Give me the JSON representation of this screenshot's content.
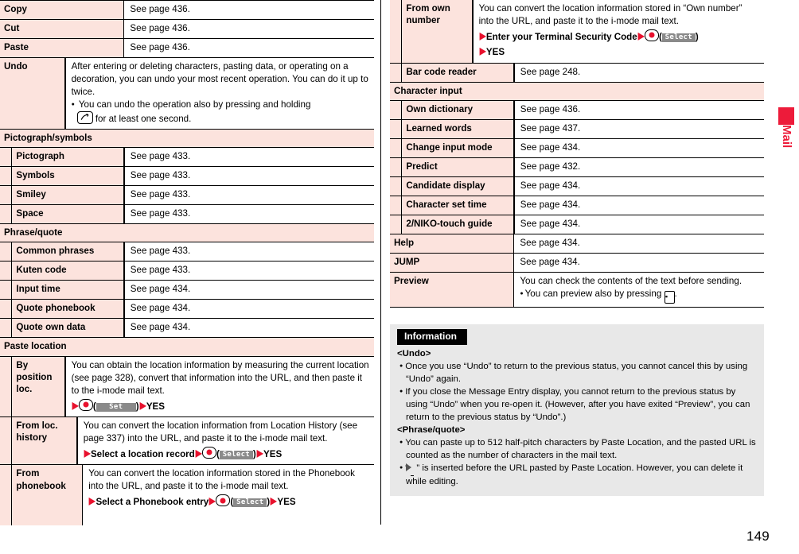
{
  "page": {
    "number": "149",
    "side_tab": "Mail",
    "accent_color": "#ed1b3a",
    "row_label_bg": "#fce3dd",
    "info_bg": "#e8e8e8"
  },
  "left_column": {
    "rows": [
      {
        "kind": "item",
        "indent": 0,
        "label": "Copy",
        "desc": "See page 436."
      },
      {
        "kind": "item",
        "indent": 0,
        "label": "Cut",
        "desc": "See page 436."
      },
      {
        "kind": "item",
        "indent": 0,
        "label": "Paste",
        "desc": "See page 436."
      },
      {
        "kind": "item",
        "indent": 0,
        "label": "Undo",
        "desc": "After entering or deleting characters, pasting data, or operating on a decoration, you can undo your most recent operation. You can do it up to twice.",
        "bullets": [
          "You can undo the operation also by pressing and holding"
        ],
        "bullet_tail": "for at least one second.",
        "bullet_icon": "call-key-icon"
      },
      {
        "kind": "section",
        "indent": 0,
        "label": "Pictograph/symbols"
      },
      {
        "kind": "item",
        "indent": 1,
        "label": "Pictograph",
        "desc": "See page 433."
      },
      {
        "kind": "item",
        "indent": 1,
        "label": "Symbols",
        "desc": "See page 433."
      },
      {
        "kind": "item",
        "indent": 1,
        "label": "Smiley",
        "desc": "See page 433."
      },
      {
        "kind": "item",
        "indent": 1,
        "label": "Space",
        "desc": "See page 433."
      },
      {
        "kind": "section",
        "indent": 0,
        "label": "Phrase/quote"
      },
      {
        "kind": "item",
        "indent": 1,
        "label": "Common phrases",
        "desc": "See page 433."
      },
      {
        "kind": "item",
        "indent": 1,
        "label": "Kuten code",
        "desc": "See page 433."
      },
      {
        "kind": "item",
        "indent": 1,
        "label": "Input time",
        "desc": "See page 434."
      },
      {
        "kind": "item",
        "indent": 1,
        "label": "Quote phonebook",
        "desc": "See page 434."
      },
      {
        "kind": "item",
        "indent": 1,
        "label": "Quote own data",
        "desc": "See page 434."
      },
      {
        "kind": "section",
        "indent": 0,
        "label": "Paste location"
      },
      {
        "kind": "item",
        "indent": 1,
        "label": "By position loc.",
        "desc": "You can obtain the location information by measuring the current location (see page 328), convert that information into the URL, and then paste it to the i-mode mail text.",
        "ops": {
          "softkey": "Set",
          "steps": [
            "",
            "YES"
          ]
        }
      },
      {
        "kind": "item",
        "indent": 1,
        "label": "From loc. history",
        "desc": "You can convert the location information from Location History (see page 337) into the URL, and paste it to the i-mode mail text.",
        "ops": {
          "softkey": "Select",
          "steps": [
            "Select a location record",
            "YES"
          ]
        }
      },
      {
        "kind": "item",
        "indent": 1,
        "label": "From phonebook",
        "desc": "You can convert the location information stored in the Phonebook into the URL, and paste it to the i-mode mail text.",
        "ops": {
          "softkey": "Select",
          "steps": [
            "Select a Phonebook entry",
            "YES"
          ]
        }
      }
    ]
  },
  "right_column": {
    "rows": [
      {
        "kind": "item",
        "indent": 1,
        "label": "From own number",
        "desc": "You can convert the location information stored in “Own number” into the URL, and paste it to the i-mode mail text.",
        "ops": {
          "softkey": "Select",
          "steps": [
            "Enter your Terminal Security Code",
            "YES"
          ]
        }
      },
      {
        "kind": "item",
        "indent": 1,
        "label": "Bar code reader",
        "desc": "See page 248."
      },
      {
        "kind": "section",
        "indent": 0,
        "label": "Character input"
      },
      {
        "kind": "item",
        "indent": 1,
        "label": "Own dictionary",
        "desc": "See page 436."
      },
      {
        "kind": "item",
        "indent": 1,
        "label": "Learned words",
        "desc": "See page 437."
      },
      {
        "kind": "item",
        "indent": 1,
        "label": "Change input mode",
        "desc": "See page 434."
      },
      {
        "kind": "item",
        "indent": 1,
        "label": "Predict",
        "desc": "See page 432."
      },
      {
        "kind": "item",
        "indent": 1,
        "label": "Candidate display",
        "desc": "See page 434."
      },
      {
        "kind": "item",
        "indent": 1,
        "label": "Character set time",
        "desc": "See page 434."
      },
      {
        "kind": "item",
        "indent": 1,
        "label": "2/NIKO-touch guide",
        "desc": "See page 434."
      },
      {
        "kind": "item",
        "indent": 0,
        "label": "Help",
        "desc": "See page 434."
      },
      {
        "kind": "item",
        "indent": 0,
        "label": "JUMP",
        "desc": "See page 434."
      },
      {
        "kind": "item",
        "indent": 0,
        "label": "Preview",
        "desc": "You can check the contents of the text before sending.",
        "bullets": [
          "You can preview also by pressing"
        ],
        "bullet_tail": ".",
        "bullet_icon": "preview-key-icon"
      }
    ],
    "information": {
      "title": "Information",
      "blocks": [
        {
          "heading": "<Undo>",
          "bullets": [
            "Once you use “Undo” to return to the previous status, you cannot cancel this by using “Undo” again.",
            "If you close the Message Entry display, you cannot return to the previous status by using “Undo” when you re-open it. (However, after you have exited “Preview”, you can return to the previous status by “Undo”.)"
          ]
        },
        {
          "heading": "<Phrase/quote>",
          "bullets": [
            "You can paste up to 512 half-pitch characters by Paste Location, and the pasted URL is counted as the number of characters in the mail text."
          ],
          "icon_bullet": {
            "pre": "“",
            "icon": "paste-marker-icon",
            "post": "” is inserted before the URL pasted by Paste Location. However, you can delete it while editing."
          }
        }
      ]
    }
  }
}
